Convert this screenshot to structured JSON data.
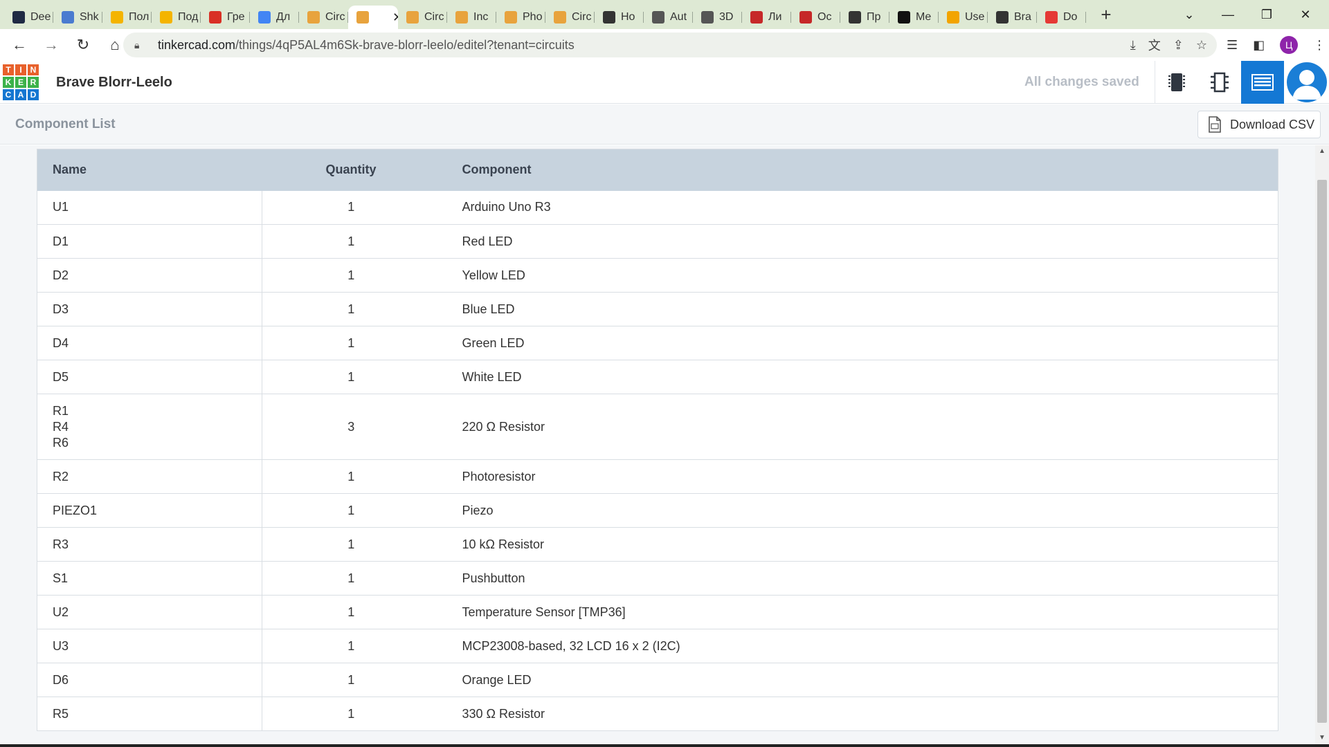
{
  "browser": {
    "tabs": [
      {
        "label": "Dee",
        "icon": "dark-hex-icon",
        "color": "#1f2a44"
      },
      {
        "label": "Shk",
        "icon": "stripes-icon",
        "color": "#4a7bd0"
      },
      {
        "label": "Пол",
        "icon": "classroom-icon",
        "color": "#f4b400"
      },
      {
        "label": "Под",
        "icon": "classroom-icon",
        "color": "#f4b400"
      },
      {
        "label": "Гре",
        "icon": "gmail-icon",
        "color": "#d93025"
      },
      {
        "label": "Дл",
        "icon": "docs-icon",
        "color": "#4285f4"
      },
      {
        "label": "Circ",
        "icon": "tinkercad-icon",
        "color": "#e8a33d"
      },
      {
        "label": "",
        "icon": "tinkercad-icon",
        "color": "#e8a33d",
        "active": true
      },
      {
        "label": "Circ",
        "icon": "tinkercad-icon",
        "color": "#e8a33d"
      },
      {
        "label": "Inc",
        "icon": "tinkercad-icon",
        "color": "#e8a33d"
      },
      {
        "label": "Pho",
        "icon": "tinkercad-icon",
        "color": "#e8a33d"
      },
      {
        "label": "Circ",
        "icon": "tinkercad-icon",
        "color": "#e8a33d"
      },
      {
        "label": "Ho",
        "icon": "globe-icon",
        "color": "#333333"
      },
      {
        "label": "Aut",
        "icon": "gear-flower-icon",
        "color": "#555555"
      },
      {
        "label": "3D",
        "icon": "gear-flower-icon",
        "color": "#555555"
      },
      {
        "label": "Ли",
        "icon": "m-logo-icon",
        "color": "#c62828"
      },
      {
        "label": "Ос",
        "icon": "m-logo-icon",
        "color": "#c62828"
      },
      {
        "label": "Пр",
        "icon": "globe-icon",
        "color": "#333333"
      },
      {
        "label": "Me",
        "icon": "wikipedia-icon",
        "color": "#111111"
      },
      {
        "label": "Use",
        "icon": "emoji-icon",
        "color": "#f2a400"
      },
      {
        "label": "Bra",
        "icon": "globe-icon",
        "color": "#333333"
      },
      {
        "label": "Do",
        "icon": "heart-icon",
        "color": "#e53935"
      }
    ],
    "url_host": "tinkercad.com",
    "url_path": "/things/4qP5AL4m6Sk-brave-blorr-leelo/editel?tenant=circuits",
    "profile_initial": "Ц"
  },
  "app": {
    "logo_letters": [
      "T",
      "I",
      "N",
      "K",
      "E",
      "R",
      "C",
      "A",
      "D"
    ],
    "logo_colors": [
      "#e8612c",
      "#e8612c",
      "#e8612c",
      "#3cb24a",
      "#3cb24a",
      "#3cb24a",
      "#1477d1",
      "#1477d1",
      "#1477d1"
    ],
    "design_title": "Brave Blorr-Leelo",
    "save_status": "All changes saved",
    "accent": "#1478d4"
  },
  "component_list": {
    "title": "Component List",
    "download_label": "Download CSV",
    "columns": [
      "Name",
      "Quantity",
      "Component"
    ],
    "rows": [
      {
        "names": [
          "U1"
        ],
        "quantity": "1",
        "component": "Arduino Uno R3"
      },
      {
        "names": [
          "D1"
        ],
        "quantity": "1",
        "component": "Red LED"
      },
      {
        "names": [
          "D2"
        ],
        "quantity": "1",
        "component": "Yellow LED"
      },
      {
        "names": [
          "D3"
        ],
        "quantity": "1",
        "component": "Blue LED"
      },
      {
        "names": [
          "D4"
        ],
        "quantity": "1",
        "component": "Green LED"
      },
      {
        "names": [
          "D5"
        ],
        "quantity": "1",
        "component": "White LED"
      },
      {
        "names": [
          "R1",
          "R4",
          "R6"
        ],
        "quantity": "3",
        "component": "220 Ω Resistor"
      },
      {
        "names": [
          "R2"
        ],
        "quantity": "1",
        "component": "Photoresistor"
      },
      {
        "names": [
          "PIEZO1"
        ],
        "quantity": "1",
        "component": "Piezo"
      },
      {
        "names": [
          "R3"
        ],
        "quantity": "1",
        "component": "10 kΩ Resistor"
      },
      {
        "names": [
          "S1"
        ],
        "quantity": "1",
        "component": "Pushbutton"
      },
      {
        "names": [
          "U2"
        ],
        "quantity": "1",
        "component": "Temperature Sensor [TMP36]"
      },
      {
        "names": [
          "U3"
        ],
        "quantity": "1",
        "component": "MCP23008-based, 32 LCD 16 x 2 (I2C)"
      },
      {
        "names": [
          "D6"
        ],
        "quantity": "1",
        "component": "Orange LED"
      },
      {
        "names": [
          "R5"
        ],
        "quantity": "1",
        "component": "330 Ω Resistor"
      }
    ]
  }
}
